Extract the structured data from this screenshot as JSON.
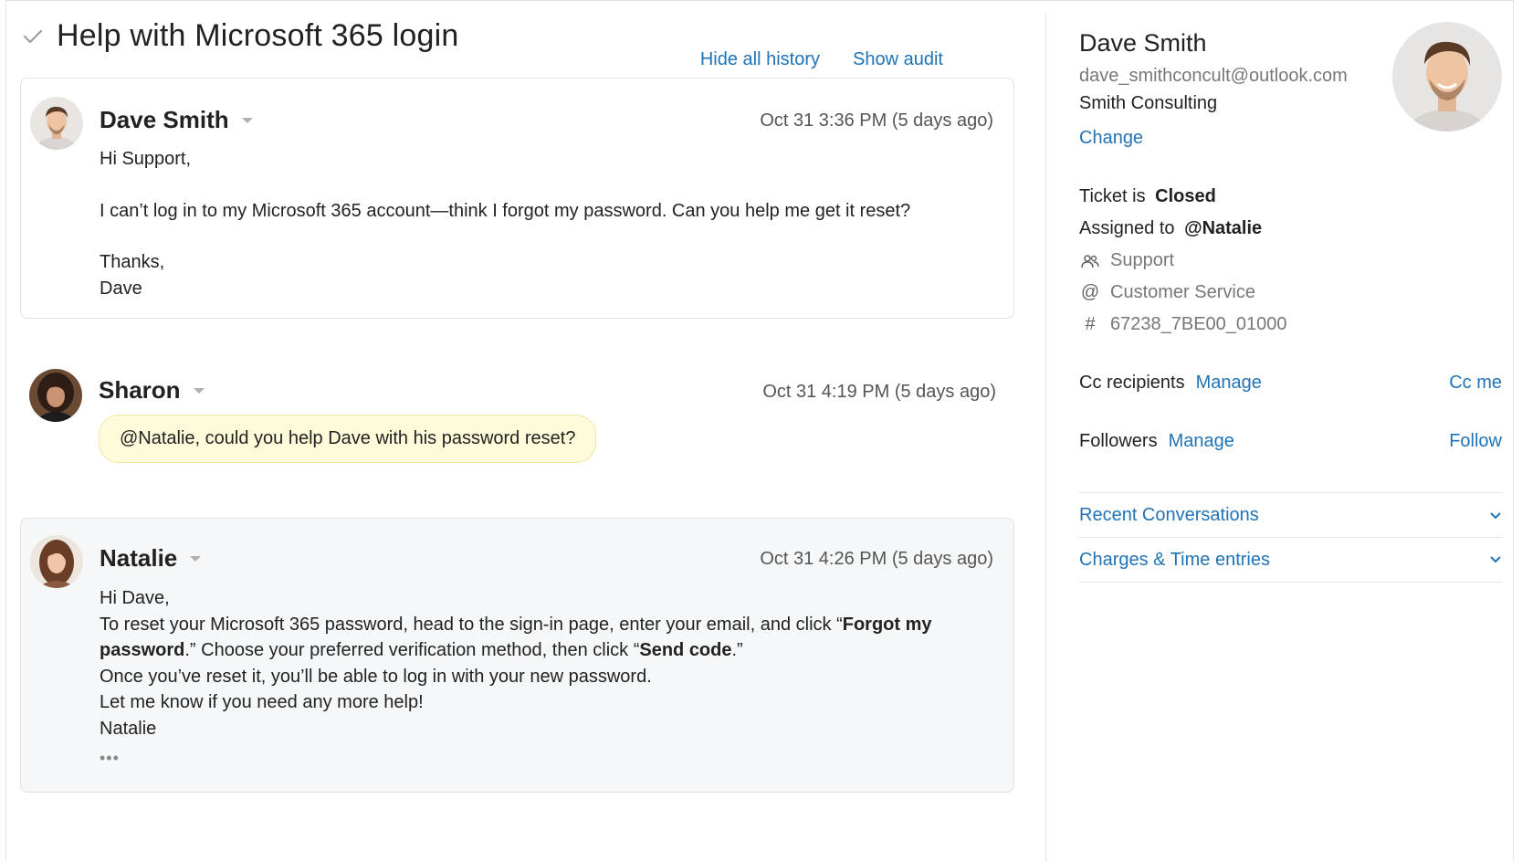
{
  "ticket": {
    "title": "Help with Microsoft 365 login",
    "links": {
      "hide_history": "Hide all history",
      "show_audit": "Show audit"
    }
  },
  "messages": [
    {
      "author": "Dave Smith",
      "timestamp": "Oct 31 3:36 PM (5 days ago)",
      "lines": [
        "Hi Support,",
        "I can’t log in to my Microsoft 365 account—think I forgot my password. Can you help me get it reset?",
        "Thanks,",
        "Dave"
      ]
    },
    {
      "author": "Sharon",
      "timestamp": "Oct 31 4:19 PM (5 days ago)",
      "note": "@Natalie, could you help Dave with his password reset?"
    },
    {
      "author": "Natalie",
      "timestamp": "Oct 31 4:26 PM (5 days ago)",
      "greeting": "Hi Dave,",
      "p1_a": "To reset your Microsoft 365 password, head to the sign-in page, enter your email, and click “",
      "p1_b1": "Forgot my",
      "p1_b2": "password",
      "p1_c": ".” Choose your preferred verification method, then click “",
      "p1_d": "Send code",
      "p1_e": ".”",
      "line3": "Once you’ve reset it, you’ll be able to log in with your new password.",
      "line4": "Let me know if you need any more help!",
      "signoff": "Natalie",
      "ellipsis": "•••"
    }
  ],
  "sidebar": {
    "name": "Dave Smith",
    "email": "dave_smithconcult@outlook.com",
    "org": "Smith Consulting",
    "change": "Change",
    "status_prefix": "Ticket is ",
    "status": "Closed",
    "assigned_prefix": "Assigned to ",
    "assignee": "@Natalie",
    "group": "Support",
    "channel": "Customer Service",
    "ticket_id": "67238_7BE00_01000",
    "cc_label": "Cc recipients",
    "cc_manage": "Manage",
    "cc_me": "Cc me",
    "followers_label": "Followers",
    "followers_manage": "Manage",
    "follow": "Follow",
    "sections": [
      "Recent Conversations",
      "Charges & Time entries"
    ]
  },
  "icons": {
    "check": "checkmark-icon",
    "group": "people-icon",
    "channel": "at-icon",
    "id": "hash-icon",
    "chevron": "chevron-down-icon"
  }
}
